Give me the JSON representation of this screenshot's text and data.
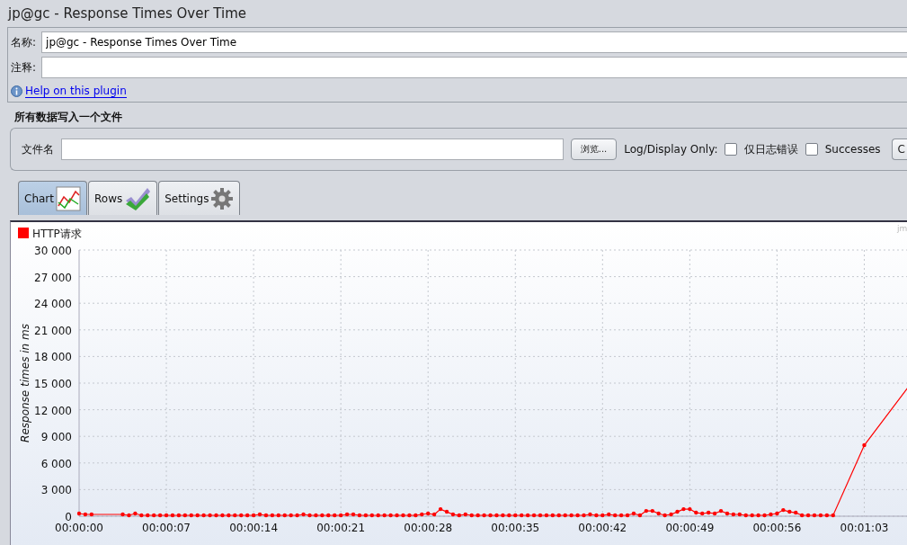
{
  "window": {
    "title": "jp@gc - Response Times Over Time"
  },
  "name_field": {
    "label": "名称:",
    "value": "jp@gc - Response Times Over Time"
  },
  "comment_field": {
    "label": "注释:"
  },
  "help_link": "Help on this plugin",
  "file_section": {
    "title": "所有数据写入一个文件",
    "filename_label": "文件名",
    "browse_button": "浏览...",
    "log_label": "Log/Display Only:",
    "checkboxes": [
      {
        "label": "仅日志错误",
        "checked": false
      },
      {
        "label": "Successes",
        "checked": false
      }
    ],
    "cut_button": "C"
  },
  "tabs": [
    {
      "label": "Chart",
      "kind": "chart",
      "selected": true
    },
    {
      "label": "Rows",
      "kind": "rows",
      "selected": false
    },
    {
      "label": "Settings",
      "kind": "settings",
      "selected": false
    }
  ],
  "chart": {
    "corner_text": "jm",
    "chart_data": {
      "type": "line",
      "grid": true,
      "ylabel": "Response times in ms",
      "xlim": [
        0,
        66.5
      ],
      "ylim": [
        0,
        30000
      ],
      "yticks": [
        {
          "value": 0,
          "label": "0"
        },
        {
          "value": 3000,
          "label": "3 000"
        },
        {
          "value": 6000,
          "label": "6 000"
        },
        {
          "value": 9000,
          "label": "9 000"
        },
        {
          "value": 12000,
          "label": "12 000"
        },
        {
          "value": 15000,
          "label": "15 000"
        },
        {
          "value": 18000,
          "label": "18 000"
        },
        {
          "value": 21000,
          "label": "21 000"
        },
        {
          "value": 24000,
          "label": "24 000"
        },
        {
          "value": 27000,
          "label": "27 000"
        },
        {
          "value": 30000,
          "label": "30 000"
        }
      ],
      "xticks": [
        {
          "value": 0,
          "label": "00:00:00"
        },
        {
          "value": 7,
          "label": "00:00:07"
        },
        {
          "value": 14,
          "label": "00:00:14"
        },
        {
          "value": 21,
          "label": "00:00:21"
        },
        {
          "value": 28,
          "label": "00:00:28"
        },
        {
          "value": 35,
          "label": "00:00:35"
        },
        {
          "value": 42,
          "label": "00:00:42"
        },
        {
          "value": 49,
          "label": "00:00:49"
        },
        {
          "value": 56,
          "label": "00:00:56"
        },
        {
          "value": 63,
          "label": "00:01:03"
        }
      ],
      "x": [
        0,
        0.5,
        1,
        3.5,
        4,
        4.5,
        5,
        5.5,
        6,
        6.5,
        7,
        7.5,
        8,
        8.5,
        9,
        9.5,
        10,
        10.5,
        11,
        11.5,
        12,
        12.5,
        13,
        13.5,
        14,
        14.5,
        15,
        15.5,
        16,
        16.5,
        17,
        17.5,
        18,
        18.5,
        19,
        19.5,
        20,
        20.5,
        21,
        21.5,
        22,
        22.5,
        23,
        23.5,
        24,
        24.5,
        25,
        25.5,
        26,
        26.5,
        27,
        27.5,
        28,
        28.5,
        29,
        29.5,
        30,
        30.5,
        31,
        31.5,
        32,
        32.5,
        33,
        33.5,
        34,
        34.5,
        35,
        35.5,
        36,
        36.5,
        37,
        37.5,
        38,
        38.5,
        39,
        39.5,
        40,
        40.5,
        41,
        41.5,
        42,
        42.5,
        43,
        43.5,
        44,
        44.5,
        45,
        45.5,
        46,
        46.5,
        47,
        47.5,
        48,
        48.5,
        49,
        49.5,
        50,
        50.5,
        51,
        51.5,
        52,
        52.5,
        53,
        53.5,
        54,
        54.5,
        55,
        55.5,
        56,
        56.5,
        57,
        57.5,
        58,
        58.5,
        59,
        59.5,
        60,
        60.5,
        63,
        66.5
      ],
      "series": [
        {
          "name": "HTTP请求",
          "color": "#ff0000",
          "values": [
            300,
            200,
            200,
            200,
            100,
            300,
            100,
            100,
            100,
            100,
            100,
            100,
            100,
            100,
            100,
            100,
            100,
            100,
            100,
            100,
            100,
            100,
            100,
            100,
            100,
            200,
            100,
            100,
            100,
            100,
            100,
            100,
            200,
            100,
            100,
            100,
            100,
            100,
            100,
            200,
            200,
            100,
            100,
            100,
            100,
            100,
            100,
            100,
            100,
            100,
            100,
            200,
            300,
            200,
            800,
            500,
            200,
            100,
            200,
            100,
            100,
            100,
            100,
            100,
            100,
            100,
            100,
            100,
            100,
            100,
            100,
            100,
            100,
            100,
            100,
            100,
            100,
            100,
            200,
            100,
            100,
            200,
            100,
            100,
            100,
            300,
            100,
            600,
            600,
            300,
            100,
            200,
            500,
            800,
            800,
            400,
            300,
            400,
            300,
            600,
            300,
            200,
            200,
            100,
            100,
            100,
            100,
            200,
            300,
            700,
            500,
            400,
            100,
            100,
            100,
            100,
            100,
            100,
            8000,
            14500
          ]
        }
      ]
    }
  }
}
